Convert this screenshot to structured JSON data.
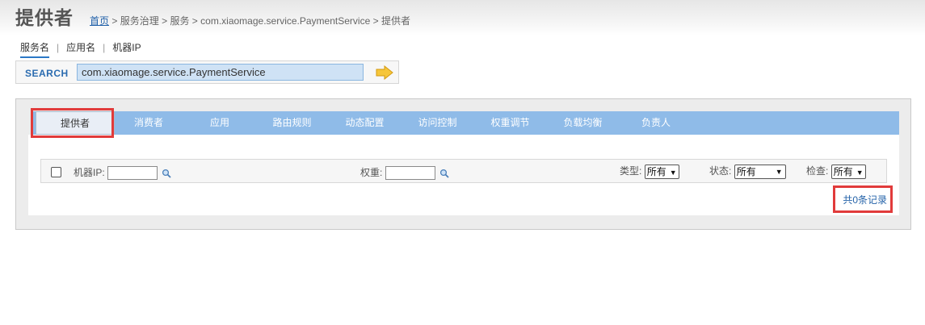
{
  "header": {
    "title": "提供者",
    "breadcrumb": {
      "home": "首页",
      "sep": ">",
      "items": [
        "服务治理",
        "服务",
        "com.xiaomage.service.PaymentService",
        "提供者"
      ]
    }
  },
  "search": {
    "tabs": [
      {
        "label": "服务名",
        "active": true
      },
      {
        "label": "应用名",
        "active": false
      },
      {
        "label": "机器IP",
        "active": false
      }
    ],
    "label": "SEARCH",
    "value": "com.xiaomage.service.PaymentService"
  },
  "nav": {
    "tabs": [
      "提供者",
      "消费者",
      "应用",
      "路由规则",
      "动态配置",
      "访问控制",
      "权重调节",
      "负载均衡",
      "负责人"
    ],
    "active_index": 0
  },
  "filters": {
    "machine_ip_label": "机器IP:",
    "weight_label": "权重:",
    "type_label": "类型:",
    "type_value": "所有",
    "status_label": "状态:",
    "status_value": "所有",
    "check_label": "检查:",
    "check_value": "所有"
  },
  "footer": {
    "record_count": "共0条记录"
  },
  "colors": {
    "tab_bar": "#8fbbe8",
    "highlight": "#e13b3b",
    "link": "#1f5fa8"
  }
}
